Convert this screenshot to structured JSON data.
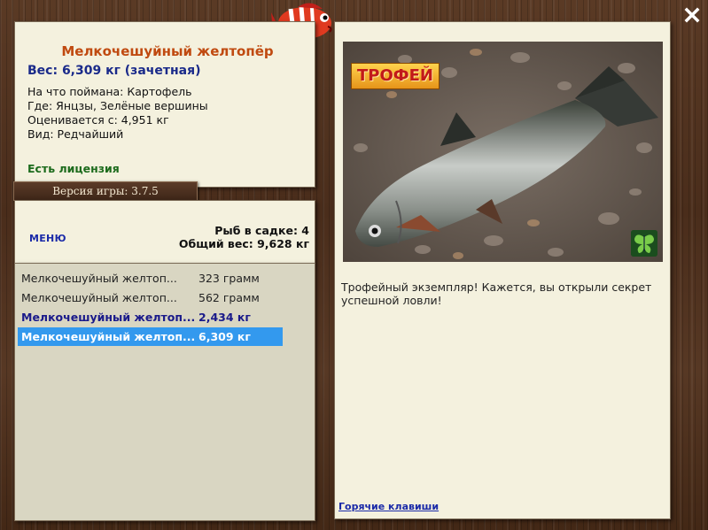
{
  "info": {
    "fish_name": "Мелкочешуйный желтопёр",
    "weight_line": "Вес: 6,309 кг (зачетная)",
    "bait": "На что поймана: Картофель",
    "place": "Где: Янцзы, Зелёные вершины",
    "estimate": "Оценивается с: 4,951 кг",
    "kind": "Вид: Редчайший",
    "license": "Есть лицензия"
  },
  "version": "Версия игры: 3.7.5",
  "menu": {
    "label": "МЕНЮ",
    "keep_count": "Рыб в садке: 4",
    "keep_weight": "Общий вес: 9,628 кг"
  },
  "catches": [
    {
      "name": "Мелкочешуйный желтоп...",
      "weight": "323 грамм",
      "style": "normal"
    },
    {
      "name": "Мелкочешуйный желтоп...",
      "weight": "562 грамм",
      "style": "normal"
    },
    {
      "name": "Мелкочешуйный желтоп...",
      "weight": "2,434 кг",
      "style": "bold"
    },
    {
      "name": "Мелкочешуйный желтоп...",
      "weight": "6,309 кг",
      "style": "selected"
    }
  ],
  "trophy_badge": "ТРОФЕЙ",
  "description": "Трофейный экземпляр! Кажется, вы открыли секрет успешной ловли!",
  "hotkeys": "Горячие клавиши",
  "icons": {
    "close": "close-icon",
    "mascot": "fish-mascot-icon",
    "butterfly": "butterfly-icon"
  }
}
